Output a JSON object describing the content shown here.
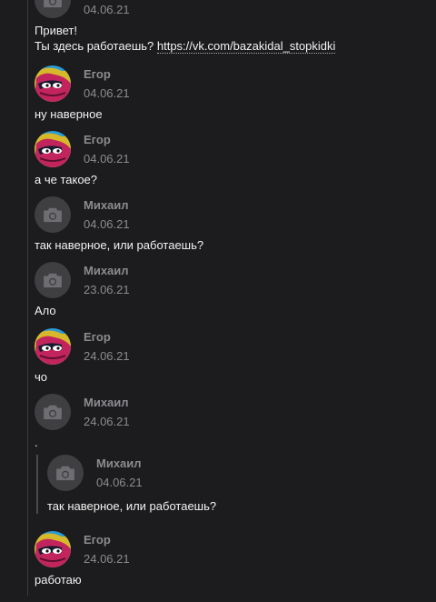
{
  "messages": [
    {
      "date": "04.06.21",
      "line1": "Привет!",
      "line2_prefix": "Ты здесь работаешь? ",
      "link": "https://vk.com/bazakidal_stopkidki"
    },
    {
      "name": "Егор",
      "date": "04.06.21",
      "text": "ну наверное"
    },
    {
      "name": "Егор",
      "date": "04.06.21",
      "text": "а че такое?"
    },
    {
      "name": "Михаил",
      "date": "04.06.21",
      "text": "так наверное, или работаешь?"
    },
    {
      "name": "Михаил",
      "date": "23.06.21",
      "text": "Ало"
    },
    {
      "name": "Егор",
      "date": "24.06.21",
      "text": "чо"
    },
    {
      "name": "Михаил",
      "date": "24.06.21",
      "text": "."
    },
    {
      "name": "Егор",
      "date": "24.06.21",
      "text": "работаю"
    }
  ],
  "quoted": {
    "name": "Михаил",
    "date": "04.06.21",
    "text": "так наверное, или работаешь?"
  },
  "icons": {
    "default_avatar": "camera-icon",
    "user_avatar": "cartoon-avatar"
  }
}
